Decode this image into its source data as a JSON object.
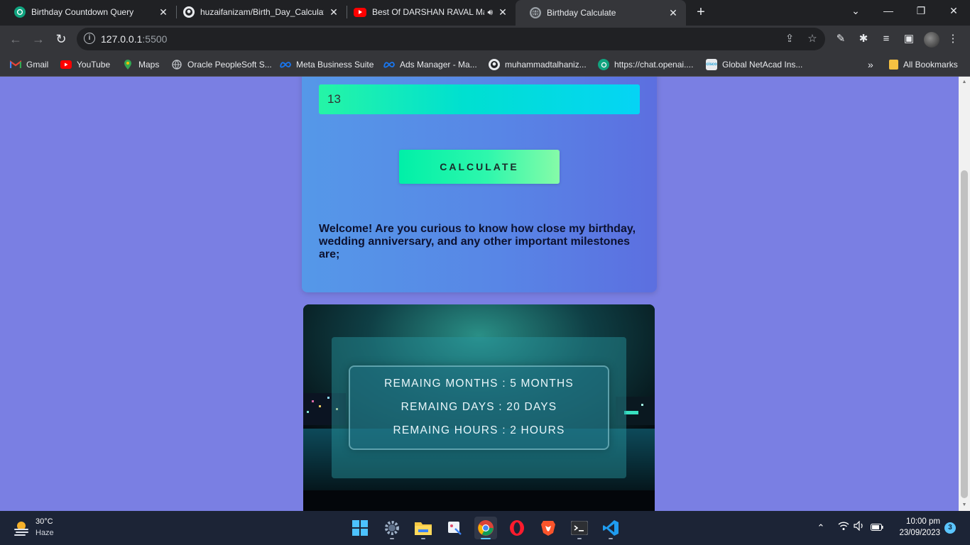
{
  "browser": {
    "tabs": [
      {
        "title": "Birthday Countdown Query",
        "icon": "chatgpt-icon",
        "active": false
      },
      {
        "title": "huzaifanizam/Birth_Day_Calculator",
        "icon": "github-icon",
        "active": false
      },
      {
        "title": "Best Of DARSHAN RAVAL Ma",
        "icon": "youtube-icon",
        "active": false,
        "audio": true
      },
      {
        "title": "Birthday Calculate",
        "icon": "globe-icon",
        "active": true
      }
    ],
    "address": {
      "host": "127.0.0.1",
      "port": ":5500"
    },
    "bookmarks": [
      {
        "label": "Gmail",
        "icon": "gmail-icon"
      },
      {
        "label": "YouTube",
        "icon": "youtube-icon"
      },
      {
        "label": "Maps",
        "icon": "maps-icon"
      },
      {
        "label": "Oracle PeopleSoft S...",
        "icon": "globe-icon"
      },
      {
        "label": "Meta Business Suite",
        "icon": "meta-icon"
      },
      {
        "label": "Ads Manager - Ma...",
        "icon": "meta-icon"
      },
      {
        "label": "muhammadtalhaniz...",
        "icon": "github-icon"
      },
      {
        "label": "https://chat.openai....",
        "icon": "chatgpt-icon"
      },
      {
        "label": "Global NetAcad Ins...",
        "icon": "cisco-icon"
      }
    ],
    "bookmarks_overflow": "»",
    "all_bookmarks": "All Bookmarks"
  },
  "page": {
    "year_value": "13",
    "calculate_label": "CALCULATE",
    "welcome_text": "Welcome! Are you curious to know how close my birthday, wedding anniversary, and any other important milestones are;",
    "results": {
      "months": "REMAING MONTHS : 5 MONTHS",
      "days": "REMAING DAYS : 20 DAYS",
      "hours": "REMAING HOURS : 2 HOURS"
    }
  },
  "taskbar": {
    "weather_temp": "30°C",
    "weather_cond": "Haze",
    "time": "10:00 pm",
    "date": "23/09/2023",
    "notifications": "3"
  },
  "colors": {
    "page_bg": "#7a7fe3",
    "card_gradient": [
      "#5598e8",
      "#5c6fe0"
    ],
    "input_gradient": [
      "#25f5a6",
      "#05d4f5"
    ],
    "button_gradient": [
      "#00f0a8",
      "#86fba8"
    ]
  }
}
